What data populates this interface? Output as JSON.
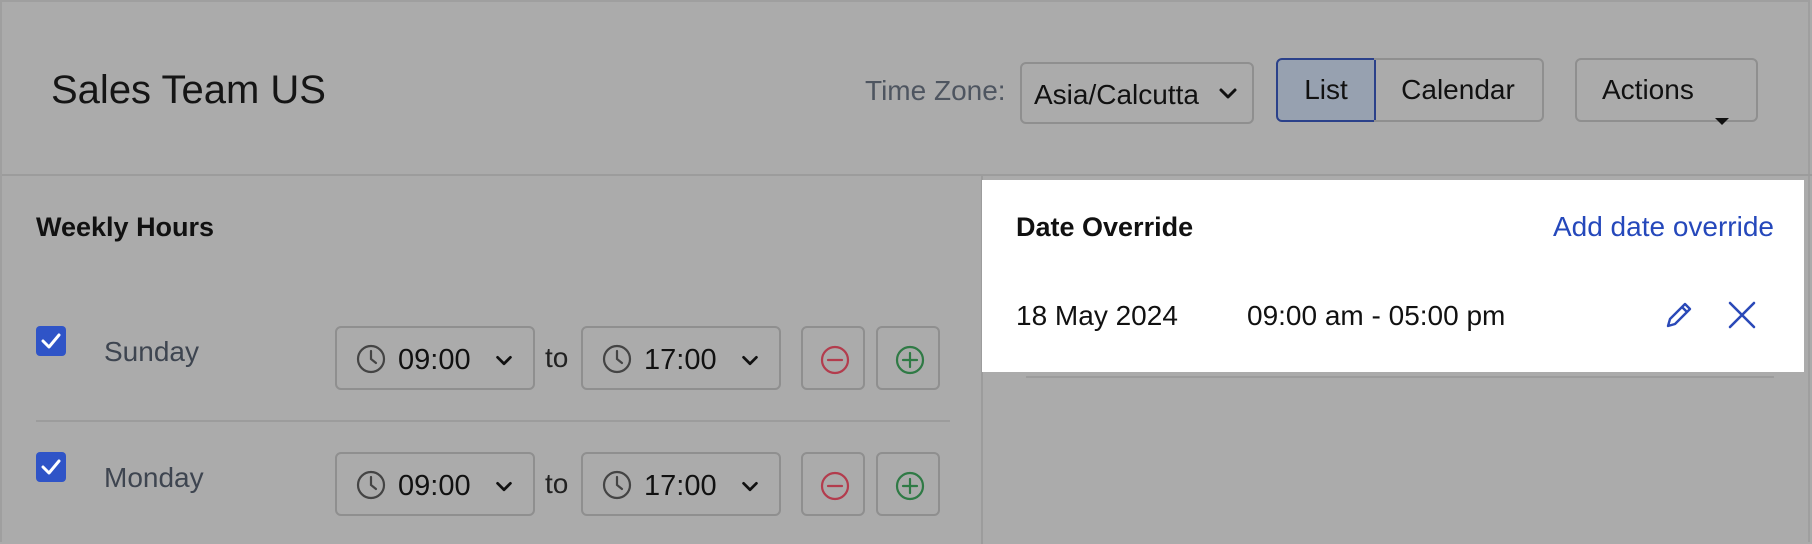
{
  "header": {
    "title": "Sales Team US",
    "timezone_label": "Time Zone:",
    "timezone_value": "Asia/Calcutta",
    "view_list_label": "List",
    "view_calendar_label": "Calendar",
    "actions_label": "Actions"
  },
  "weekly_hours": {
    "title": "Weekly Hours",
    "to_label": "to",
    "days": [
      {
        "name": "Sunday",
        "checked": true,
        "start": "09:00",
        "end": "17:00"
      },
      {
        "name": "Monday",
        "checked": true,
        "start": "09:00",
        "end": "17:00"
      }
    ]
  },
  "date_override": {
    "title": "Date Override",
    "add_label": "Add date override",
    "entries": [
      {
        "date": "18 May 2024",
        "time_range": "09:00 am - 05:00 pm"
      }
    ]
  },
  "colors": {
    "overlay": "#ababab",
    "primary": "#2f54c7",
    "link": "#2548bb",
    "remove": "#c0374a",
    "add": "#2f8a47"
  },
  "icons": {
    "timezone_chevron": "chevron-down-icon",
    "actions_caret": "caret-down-icon",
    "time_clock": "clock-icon",
    "remove": "minus-circle-icon",
    "add": "plus-circle-icon",
    "edit": "pencil-icon",
    "delete": "close-icon",
    "checkbox": "check-icon"
  }
}
